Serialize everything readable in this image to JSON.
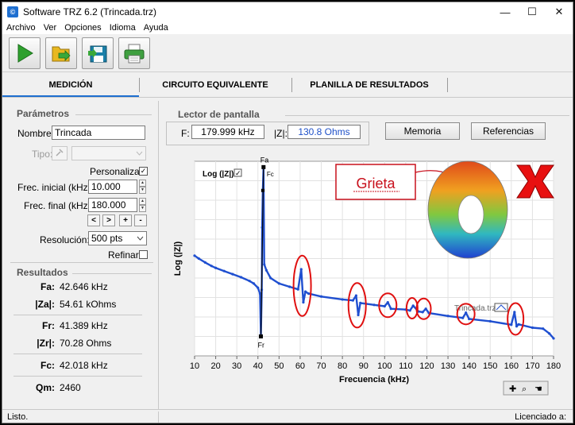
{
  "window": {
    "title": "Software TRZ 6.2 (Trincada.trz)",
    "app_icon_glyph": "©",
    "controls": {
      "minimize": "—",
      "maximize": "☐",
      "close": "✕"
    }
  },
  "menu": [
    "Archivo",
    "Ver",
    "Opciones",
    "Idioma",
    "Ayuda"
  ],
  "toolbar": {
    "buttons": [
      {
        "name": "run-icon",
        "color": "#2ea02e"
      },
      {
        "name": "open-folder-icon",
        "color": "#e8b820"
      },
      {
        "name": "save-icon",
        "color": "#1a7fa8"
      },
      {
        "name": "print-icon",
        "color": "#3fa040"
      }
    ]
  },
  "tabs": [
    {
      "label": "MEDICIÓN",
      "active": true
    },
    {
      "label": "CIRCUITO EQUIVALENTE",
      "active": false
    },
    {
      "label": "PLANILLA DE RESULTADOS",
      "active": false
    }
  ],
  "parametros": {
    "title": "Parámetros",
    "nombre_label": "Nombre:",
    "nombre_value": "Trincada",
    "tipo_label": "Tipo:",
    "tipo_value": "",
    "personalizar_label": "Personalizar",
    "personalizar_checked": true,
    "frec_inicial_label": "Frec. inicial (kHz):",
    "frec_inicial_value": "10.000",
    "frec_final_label": "Frec. final (kHz):",
    "frec_final_value": "180.000",
    "nav_buttons": [
      "<",
      ">",
      "+",
      "-"
    ],
    "resolucion_label": "Resolución:",
    "resolucion_value": "500 pts",
    "refinar_label": "Refinar",
    "refinar_checked": false
  },
  "resultados": {
    "title": "Resultados",
    "rows": [
      {
        "label": "Fa:",
        "value": "42.646 kHz"
      },
      {
        "label": "|Za|:",
        "value": "54.61 kOhms"
      },
      {
        "label": "Fr:",
        "value": "41.389 kHz"
      },
      {
        "label": "|Zr|:",
        "value": "70.28 Ohms"
      },
      {
        "label": "Fc:",
        "value": "42.018 kHz"
      },
      {
        "label": "Qm:",
        "value": "2460"
      }
    ]
  },
  "lector": {
    "title": "Lector de pantalla",
    "f_label": "F:",
    "f_value": "179.999 kHz",
    "z_label": "|Z|:",
    "z_value": "130.8 Ohms",
    "z_color": "#1e50c8"
  },
  "buttons": {
    "memoria": "Memoria",
    "referencias": "Referencias"
  },
  "chart_data": {
    "type": "line",
    "xlabel": "Frecuencia (kHz)",
    "ylabel": "Log (|Z|)",
    "log_toggle_label": "Log (|Z|)",
    "log_toggle_checked": true,
    "xlim": [
      10,
      180
    ],
    "x_ticks": [
      10,
      20,
      30,
      40,
      50,
      60,
      70,
      80,
      90,
      100,
      110,
      120,
      130,
      140,
      150,
      160,
      170,
      180
    ],
    "grid": true,
    "series_color": "#1f4fd0",
    "series": [
      {
        "name": "Trincada.trz",
        "x": [
          10,
          12,
          15,
          18,
          20,
          24,
          28,
          32,
          36,
          38,
          40,
          41,
          41.4,
          41.8,
          42,
          42.3,
          42.65,
          43,
          44,
          46,
          50,
          55,
          59,
          60.5,
          61.5,
          62.5,
          64,
          70,
          80,
          85,
          86.5,
          87.5,
          88.5,
          95,
          100,
          101.5,
          103,
          110,
          112,
          113.5,
          116,
          118,
          119.5,
          121,
          130,
          137,
          138.5,
          140,
          150,
          160,
          161.5,
          162.5,
          163.5,
          170,
          175,
          178,
          180
        ],
        "y": [
          6.15,
          6.0,
          5.8,
          5.62,
          5.52,
          5.36,
          5.2,
          5.04,
          4.85,
          4.72,
          4.5,
          4.2,
          2.0,
          4.4,
          7.6,
          9.5,
          10.7,
          5.7,
          5.4,
          5.0,
          4.72,
          4.55,
          4.42,
          5.45,
          3.75,
          4.3,
          4.2,
          4.05,
          3.9,
          3.85,
          4.1,
          3.1,
          3.72,
          3.62,
          3.55,
          3.75,
          3.42,
          3.38,
          3.33,
          3.58,
          3.28,
          3.25,
          3.42,
          3.2,
          3.05,
          2.95,
          3.22,
          2.9,
          2.78,
          2.6,
          3.25,
          2.52,
          2.62,
          2.45,
          2.4,
          2.15,
          1.9
        ]
      }
    ],
    "point_labels": [
      "Fa",
      "Fc",
      "Fr"
    ],
    "annotations": {
      "crack_label": "Grieta",
      "crack_label_color": "#c8101c",
      "mark_color": "#e01010"
    }
  },
  "status": {
    "left": "Listo.",
    "right": "Licenciado a:"
  }
}
